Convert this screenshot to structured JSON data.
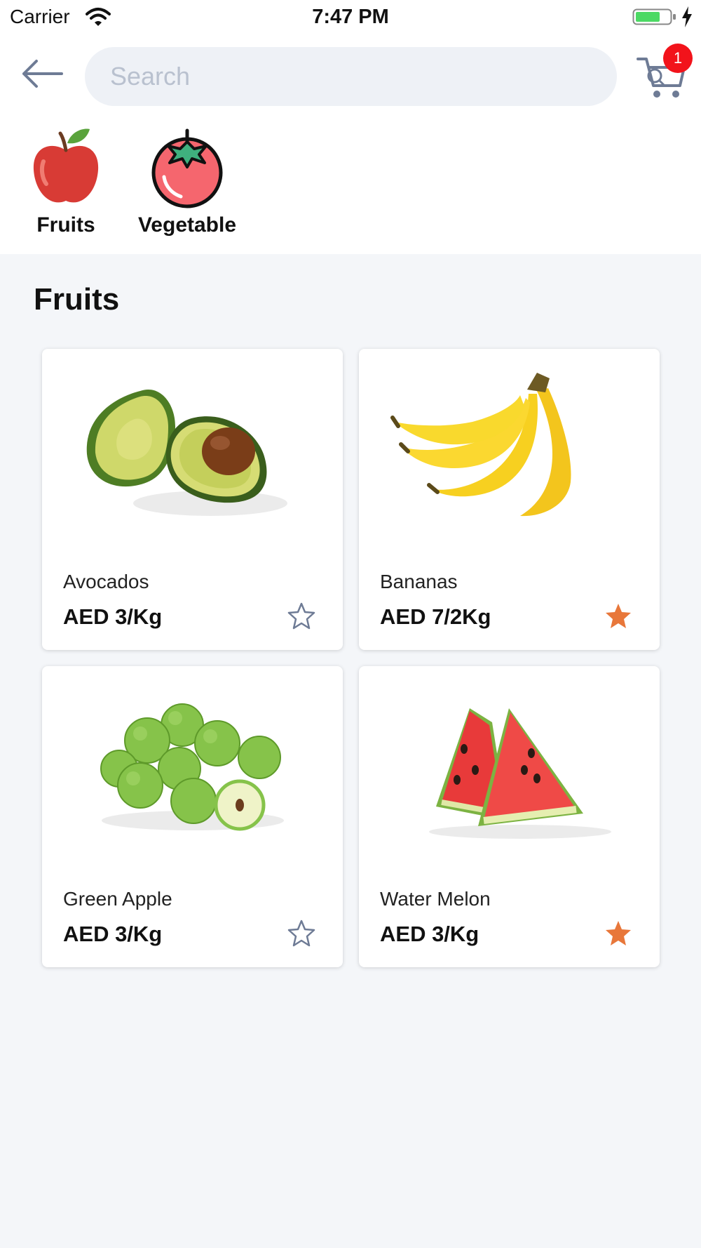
{
  "status_bar": {
    "carrier": "Carrier",
    "time": "7:47 PM",
    "battery_color": "#4cd964"
  },
  "header": {
    "back_icon": "arrow-left-icon",
    "search": {
      "placeholder": "Search",
      "value": "",
      "icon": "search-icon"
    },
    "cart": {
      "icon": "cart-icon",
      "badge_count": "1",
      "badge_color": "#f2131b"
    }
  },
  "categories": [
    {
      "label": "Fruits",
      "icon": "apple-icon"
    },
    {
      "label": "Vegetable",
      "icon": "tomato-icon"
    }
  ],
  "section": {
    "title": "Fruits"
  },
  "products": [
    {
      "name": "Avocados",
      "price": "AED 3/Kg",
      "image": "avocado-image",
      "favorite": false
    },
    {
      "name": "Bananas",
      "price": "AED 7/2Kg",
      "image": "banana-image",
      "favorite": true
    },
    {
      "name": "Green Apple",
      "price": "AED 3/Kg",
      "image": "green-apple-image",
      "favorite": false
    },
    {
      "name": "Water Melon",
      "price": "AED 3/Kg",
      "image": "watermelon-image",
      "favorite": true
    }
  ],
  "colors": {
    "accent": "#e8773a",
    "icon_gray": "#6e7b95",
    "background": "#f4f6f9"
  }
}
